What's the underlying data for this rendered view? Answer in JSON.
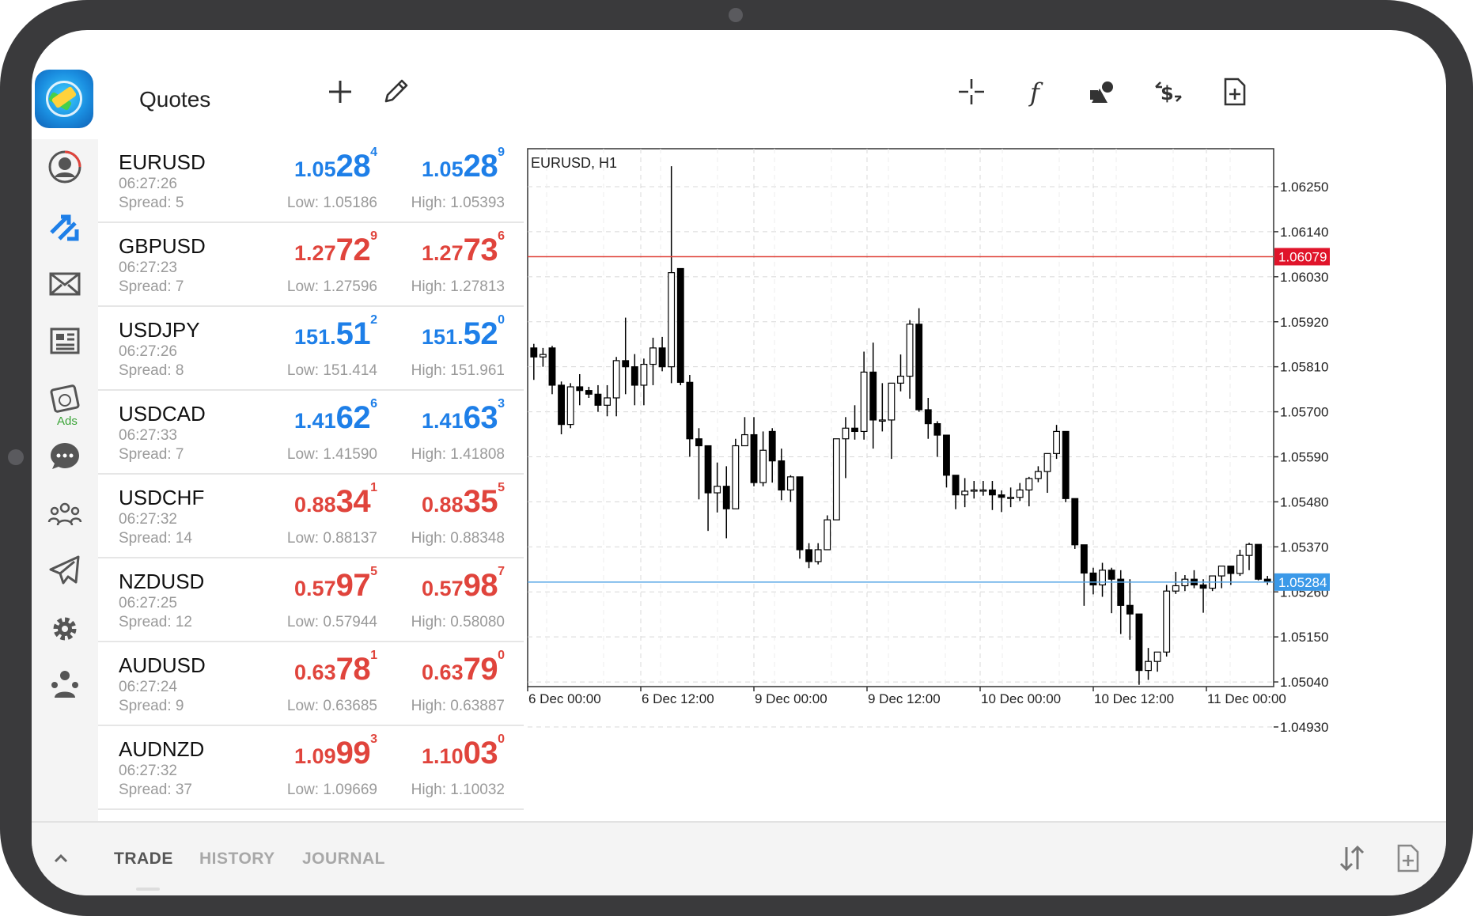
{
  "header": {
    "title": "Quotes",
    "icons": [
      "add-icon",
      "edit-icon",
      "crosshair-icon",
      "function-icon",
      "objects-icon",
      "trade-icon",
      "new-document-icon"
    ]
  },
  "nav": {
    "items": [
      "account-icon",
      "trade-arrows-icon",
      "mail-icon",
      "news-icon",
      "ads-icon",
      "chat-icon",
      "community-icon",
      "telegram-icon",
      "settings-icon",
      "traders-icon"
    ],
    "ads_label": "Ads"
  },
  "quotes": [
    {
      "symbol": "EURUSD",
      "time": "06:27:26",
      "spread": "Spread: 5",
      "bid": {
        "pre": "1.05",
        "big": "28",
        "sup": "4"
      },
      "ask": {
        "pre": "1.05",
        "big": "28",
        "sup": "9"
      },
      "low": "Low: 1.05186",
      "high": "High: 1.05393",
      "dir": "up"
    },
    {
      "symbol": "GBPUSD",
      "time": "06:27:23",
      "spread": "Spread: 7",
      "bid": {
        "pre": "1.27",
        "big": "72",
        "sup": "9"
      },
      "ask": {
        "pre": "1.27",
        "big": "73",
        "sup": "6"
      },
      "low": "Low: 1.27596",
      "high": "High: 1.27813",
      "dir": "down"
    },
    {
      "symbol": "USDJPY",
      "time": "06:27:26",
      "spread": "Spread: 8",
      "bid": {
        "pre": "151.",
        "big": "51",
        "sup": "2"
      },
      "ask": {
        "pre": "151.",
        "big": "52",
        "sup": "0"
      },
      "low": "Low: 151.414",
      "high": "High: 151.961",
      "dir": "up"
    },
    {
      "symbol": "USDCAD",
      "time": "06:27:33",
      "spread": "Spread: 7",
      "bid": {
        "pre": "1.41",
        "big": "62",
        "sup": "6"
      },
      "ask": {
        "pre": "1.41",
        "big": "63",
        "sup": "3"
      },
      "low": "Low: 1.41590",
      "high": "High: 1.41808",
      "dir": "up"
    },
    {
      "symbol": "USDCHF",
      "time": "06:27:32",
      "spread": "Spread: 14",
      "bid": {
        "pre": "0.88",
        "big": "34",
        "sup": "1"
      },
      "ask": {
        "pre": "0.88",
        "big": "35",
        "sup": "5"
      },
      "low": "Low: 0.88137",
      "high": "High: 0.88348",
      "dir": "down"
    },
    {
      "symbol": "NZDUSD",
      "time": "06:27:25",
      "spread": "Spread: 12",
      "bid": {
        "pre": "0.57",
        "big": "97",
        "sup": "5"
      },
      "ask": {
        "pre": "0.57",
        "big": "98",
        "sup": "7"
      },
      "low": "Low: 0.57944",
      "high": "High: 0.58080",
      "dir": "down"
    },
    {
      "symbol": "AUDUSD",
      "time": "06:27:24",
      "spread": "Spread: 9",
      "bid": {
        "pre": "0.63",
        "big": "78",
        "sup": "1"
      },
      "ask": {
        "pre": "0.63",
        "big": "79",
        "sup": "0"
      },
      "low": "Low: 0.63685",
      "high": "High: 0.63887",
      "dir": "down"
    },
    {
      "symbol": "AUDNZD",
      "time": "06:27:32",
      "spread": "Spread: 37",
      "bid": {
        "pre": "1.09",
        "big": "99",
        "sup": "3"
      },
      "ask": {
        "pre": "1.10",
        "big": "03",
        "sup": "0"
      },
      "low": "Low: 1.09669",
      "high": "High: 1.10032",
      "dir": "down"
    }
  ],
  "colors": {
    "up": "#1e7fe8",
    "down": "#e0443c",
    "ask_line": "#e0443c",
    "bid_line": "#5aa8e6"
  },
  "chart": {
    "title": "EURUSD, H1",
    "y_ticks": [
      "1.06250",
      "1.06140",
      "1.06030",
      "1.05920",
      "1.05810",
      "1.05700",
      "1.05590",
      "1.05480",
      "1.05370",
      "1.05260",
      "1.05150",
      "1.05040",
      "1.04930"
    ],
    "x_ticks": [
      "6 Dec 00:00",
      "6 Dec 12:00",
      "9 Dec 00:00",
      "9 Dec 12:00",
      "10 Dec 00:00",
      "10 Dec 12:00",
      "11 Dec 00:00"
    ],
    "ask_label": "1.06079",
    "bid_label": "1.05284"
  },
  "chart_data": {
    "type": "candlestick",
    "title": "EURUSD, H1",
    "ylim": [
      1.0482,
      1.0636
    ],
    "ask_price": 1.06079,
    "bid_price": 1.05284,
    "ohlc": [
      [
        1.05856,
        1.05866,
        1.05778,
        1.05834
      ],
      [
        1.05834,
        1.05856,
        1.0581,
        1.0584
      ],
      [
        1.05856,
        1.05861,
        1.05743,
        1.05765
      ],
      [
        1.05765,
        1.05774,
        1.05645,
        1.05669
      ],
      [
        1.05669,
        1.0577,
        1.0566,
        1.05761
      ],
      [
        1.05761,
        1.05792,
        1.05716,
        1.05752
      ],
      [
        1.05752,
        1.05761,
        1.05734,
        1.05743
      ],
      [
        1.05743,
        1.05765,
        1.057,
        1.05716
      ],
      [
        1.05716,
        1.05765,
        1.05689,
        1.05734
      ],
      [
        1.05734,
        1.05834,
        1.05689,
        1.05825
      ],
      [
        1.05825,
        1.0593,
        1.05743,
        1.0581
      ],
      [
        1.0581,
        1.05841,
        1.05716,
        1.05765
      ],
      [
        1.05765,
        1.0583,
        1.05716,
        1.05816
      ],
      [
        1.05816,
        1.05881,
        1.05765,
        1.05856
      ],
      [
        1.05856,
        1.05883,
        1.05799,
        1.0581
      ],
      [
        1.0581,
        1.063,
        1.0577,
        1.0604
      ],
      [
        1.0605,
        1.0605,
        1.05765,
        1.05772
      ],
      [
        1.05772,
        1.0579,
        1.0559,
        1.05634
      ],
      [
        1.05634,
        1.0566,
        1.05486,
        1.05617
      ],
      [
        1.05617,
        1.05617,
        1.05409,
        1.05502
      ],
      [
        1.05502,
        1.05576,
        1.05454,
        1.05518
      ],
      [
        1.05518,
        1.05567,
        1.05391,
        1.05463
      ],
      [
        1.05463,
        1.05634,
        1.05463,
        1.05617
      ],
      [
        1.05617,
        1.05687,
        1.05617,
        1.05644
      ],
      [
        1.05644,
        1.05687,
        1.05518,
        1.05527
      ],
      [
        1.05527,
        1.05652,
        1.05518,
        1.05606
      ],
      [
        1.05652,
        1.0566,
        1.05527,
        1.0558
      ],
      [
        1.0558,
        1.0561,
        1.05484,
        1.05509
      ],
      [
        1.05509,
        1.05545,
        1.0548,
        1.05541
      ],
      [
        1.05541,
        1.05541,
        1.05341,
        1.05363
      ],
      [
        1.05363,
        1.05379,
        1.05318,
        1.05334
      ],
      [
        1.05334,
        1.05379,
        1.05327,
        1.05363
      ],
      [
        1.05363,
        1.05447,
        1.05363,
        1.05436
      ],
      [
        1.05436,
        1.05634,
        1.05436,
        1.05634
      ],
      [
        1.05634,
        1.05687,
        1.05538,
        1.0566
      ],
      [
        1.0566,
        1.05716,
        1.05632,
        1.05652
      ],
      [
        1.05652,
        1.05847,
        1.05632,
        1.05797
      ],
      [
        1.05797,
        1.05869,
        1.0561,
        1.0568
      ],
      [
        1.0568,
        1.0577,
        1.05652,
        1.0568
      ],
      [
        1.0568,
        1.05769,
        1.05585,
        1.0577
      ],
      [
        1.0577,
        1.0584,
        1.0575,
        1.05787
      ],
      [
        1.05787,
        1.05924,
        1.05732,
        1.05914
      ],
      [
        1.05914,
        1.05953,
        1.057,
        1.05705
      ],
      [
        1.05705,
        1.05734,
        1.05634,
        1.05671
      ],
      [
        1.05671,
        1.05677,
        1.0559,
        1.05643
      ],
      [
        1.05643,
        1.05643,
        1.05515,
        1.05545
      ],
      [
        1.05545,
        1.05545,
        1.05462,
        1.05497
      ],
      [
        1.05497,
        1.05538,
        1.05467,
        1.05506
      ],
      [
        1.05506,
        1.05531,
        1.05488,
        1.05509
      ],
      [
        1.05509,
        1.05531,
        1.05495,
        1.05509
      ],
      [
        1.05509,
        1.05531,
        1.0546,
        1.05497
      ],
      [
        1.05497,
        1.05508,
        1.05455,
        1.05491
      ],
      [
        1.05491,
        1.05515,
        1.05467,
        1.05491
      ],
      [
        1.05491,
        1.05526,
        1.05482,
        1.05509
      ],
      [
        1.05509,
        1.05541,
        1.05469,
        1.05537
      ],
      [
        1.05537,
        1.05567,
        1.05528,
        1.05554
      ],
      [
        1.05554,
        1.05598,
        1.05502,
        1.05598
      ],
      [
        1.05598,
        1.05668,
        1.05585,
        1.05652
      ],
      [
        1.05652,
        1.05652,
        1.05479,
        1.05488
      ],
      [
        1.05488,
        1.05488,
        1.05365,
        1.05375
      ],
      [
        1.05375,
        1.05375,
        1.05226,
        1.05306
      ],
      [
        1.05306,
        1.05319,
        1.05254,
        1.05277
      ],
      [
        1.05277,
        1.05331,
        1.05248,
        1.05313
      ],
      [
        1.05313,
        1.05319,
        1.05208,
        1.05291
      ],
      [
        1.05291,
        1.05313,
        1.05157,
        1.05227
      ],
      [
        1.05227,
        1.05291,
        1.05143,
        1.05206
      ],
      [
        1.05206,
        1.05206,
        1.05033,
        1.05068
      ],
      [
        1.05068,
        1.05123,
        1.05045,
        1.0509
      ],
      [
        1.0509,
        1.05113,
        1.05065,
        1.05113
      ],
      [
        1.05113,
        1.05277,
        1.05102,
        1.05262
      ],
      [
        1.05262,
        1.05309,
        1.05255,
        1.05275
      ],
      [
        1.05275,
        1.05301,
        1.05262,
        1.05291
      ],
      [
        1.05291,
        1.05313,
        1.05269,
        1.05277
      ],
      [
        1.05277,
        1.05291,
        1.05209,
        1.05269
      ],
      [
        1.05269,
        1.05299,
        1.05262,
        1.05299
      ],
      [
        1.05299,
        1.05323,
        1.05269,
        1.05323
      ],
      [
        1.05323,
        1.05323,
        1.05277,
        1.05305
      ],
      [
        1.05305,
        1.05363,
        1.05299,
        1.05349
      ],
      [
        1.05349,
        1.0538,
        1.05313,
        1.05376
      ],
      [
        1.05376,
        1.05376,
        1.05288,
        1.05291
      ],
      [
        1.05291,
        1.05299,
        1.05277,
        1.05284
      ]
    ]
  }
}
